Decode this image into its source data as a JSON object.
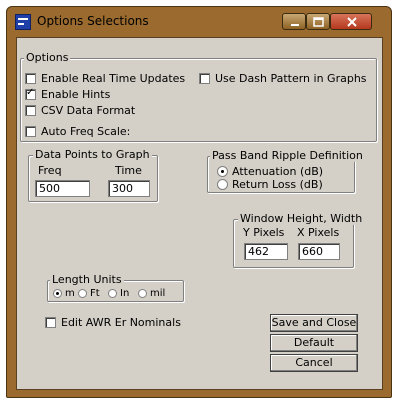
{
  "window": {
    "title": "Options Selections"
  },
  "options_group": {
    "legend": "Options",
    "enable_real_time_updates": {
      "label": "Enable Real Time Updates",
      "checked": false
    },
    "use_dash_pattern": {
      "label": "Use Dash Pattern in Graphs",
      "checked": false
    },
    "enable_hints": {
      "label": "Enable Hints",
      "checked": true
    },
    "csv_data_format": {
      "label": "CSV Data Format",
      "checked": false
    },
    "auto_freq_scale": {
      "label": "Auto Freq Scale:",
      "checked": false
    }
  },
  "data_points": {
    "legend": "Data Points to Graph",
    "freq_label": "Freq",
    "time_label": "Time",
    "freq_value": "500",
    "time_value": "300"
  },
  "pass_band": {
    "legend": "Pass Band Ripple Definition",
    "attenuation": {
      "label": "Attenuation (dB)",
      "selected": true
    },
    "return_loss": {
      "label": "Return Loss (dB)",
      "selected": false
    }
  },
  "window_size": {
    "legend": "Window Height, Width",
    "y_label": "Y Pixels",
    "x_label": "X Pixels",
    "y_value": "462",
    "x_value": "660"
  },
  "length_units": {
    "legend": "Length Units",
    "options": [
      {
        "label": "m",
        "selected": true
      },
      {
        "label": "Ft",
        "selected": false
      },
      {
        "label": "In",
        "selected": false
      },
      {
        "label": "mil",
        "selected": false
      }
    ]
  },
  "edit_awr": {
    "label": "Edit AWR Er Nominals",
    "checked": false
  },
  "buttons": {
    "save_close": "Save and Close",
    "default": "Default",
    "cancel": "Cancel"
  }
}
